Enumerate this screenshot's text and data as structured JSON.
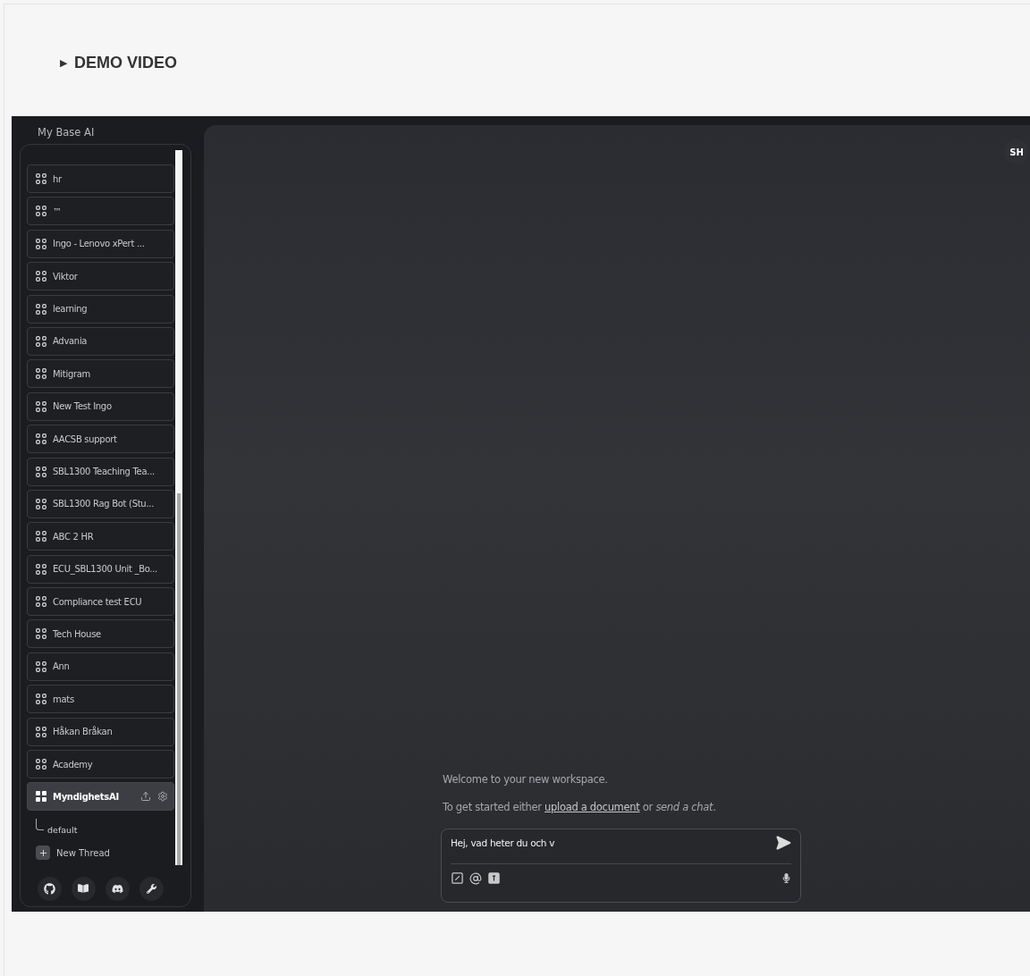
{
  "summary": {
    "marker": "▶",
    "label": "DEMO VIDEO"
  },
  "sidebar": {
    "title": "My Base AI",
    "workspaces": [
      {
        "name": "hr",
        "selected": false
      },
      {
        "name": "™",
        "selected": false
      },
      {
        "name": "Ingo - Lenovo xPert ...",
        "selected": false
      },
      {
        "name": "Viktor",
        "selected": false
      },
      {
        "name": "learning",
        "selected": false
      },
      {
        "name": "Advania",
        "selected": false
      },
      {
        "name": "Mitigram",
        "selected": false
      },
      {
        "name": "New Test Ingo",
        "selected": false
      },
      {
        "name": "AACSB support",
        "selected": false
      },
      {
        "name": "SBL1300 Teaching Tea...",
        "selected": false
      },
      {
        "name": "SBL1300 Rag Bot (Stu...",
        "selected": false
      },
      {
        "name": "ABC 2 HR",
        "selected": false
      },
      {
        "name": "ECU_SBL1300 Unit _Bo...",
        "selected": false
      },
      {
        "name": "Compliance test ECU",
        "selected": false
      },
      {
        "name": "Tech House",
        "selected": false
      },
      {
        "name": "Ann",
        "selected": false
      },
      {
        "name": "mats",
        "selected": false
      },
      {
        "name": "Håkan Bråkan",
        "selected": false
      },
      {
        "name": "Academy",
        "selected": false
      },
      {
        "name": "MyndighetsAI",
        "selected": true,
        "threads": [
          {
            "name": "default"
          }
        ]
      }
    ],
    "new_thread": "New Thread"
  },
  "main": {
    "avatar": "SH",
    "welcome": "Welcome to your new workspace.",
    "hint": {
      "before": "To get started either ",
      "link": "upload a document",
      "after": " or *send a chat*."
    },
    "composer": {
      "value": "Hej, vad heter du och v"
    }
  }
}
